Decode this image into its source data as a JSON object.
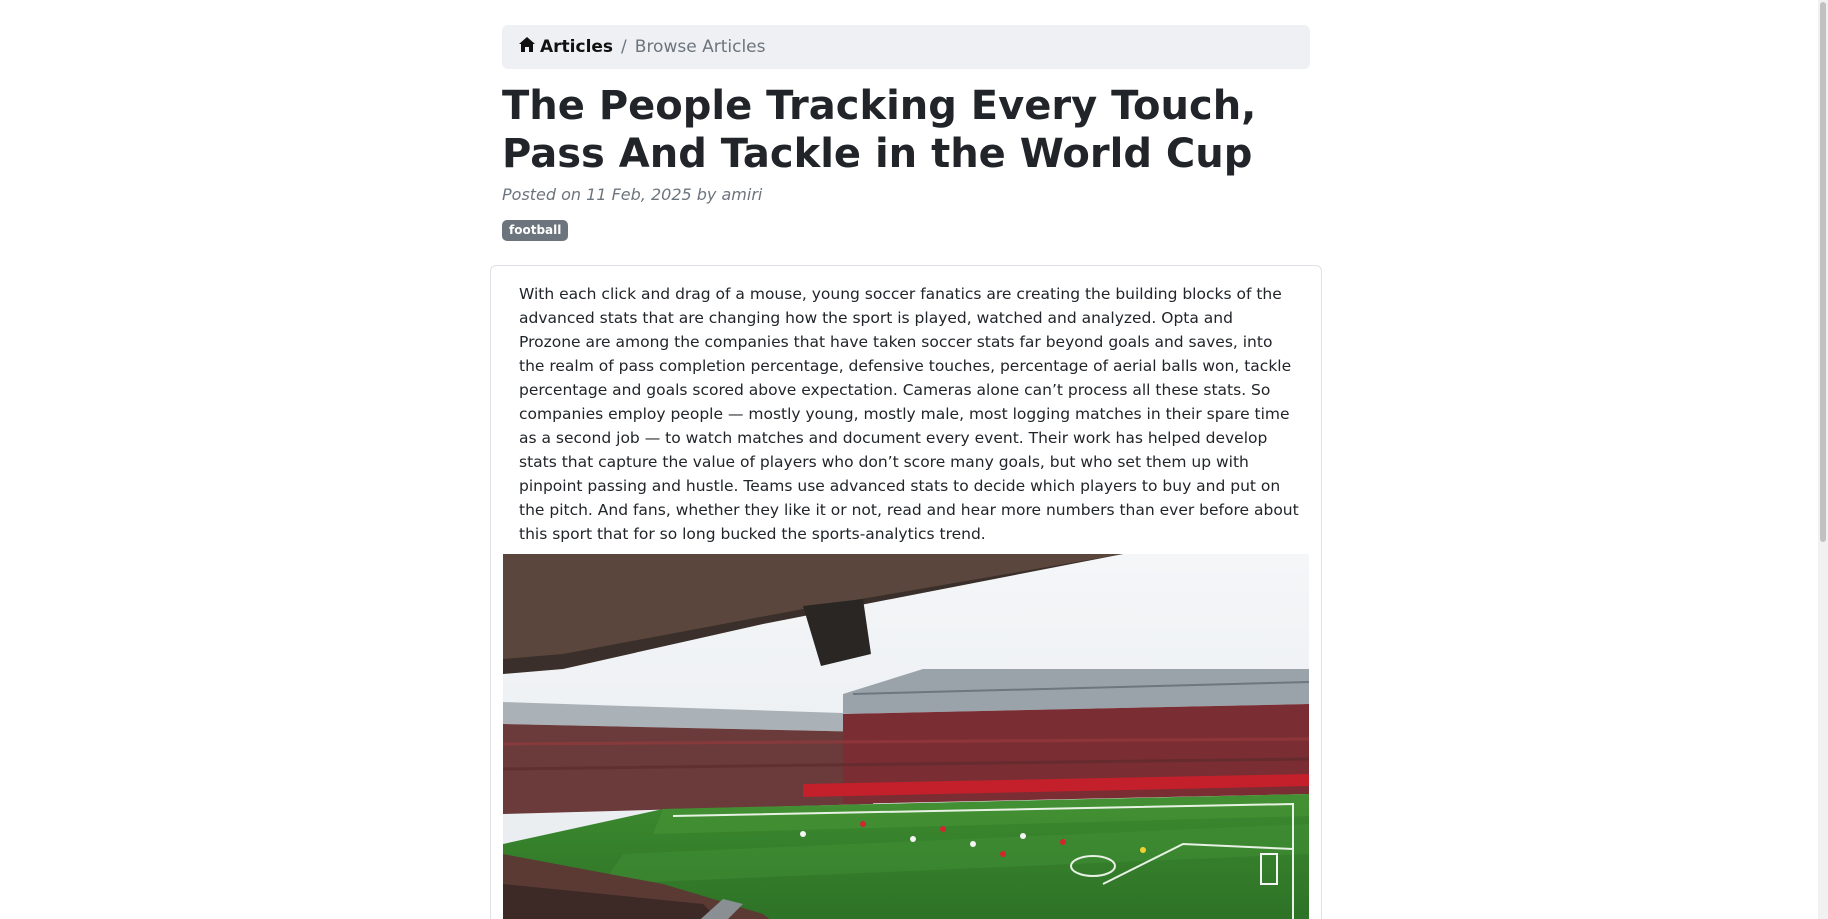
{
  "breadcrumb": {
    "home_icon": "home-icon",
    "home_label": "Articles",
    "separator": "/",
    "current_label": "Browse Articles"
  },
  "article": {
    "title": "The People Tracking Every Touch, Pass And Tackle in the World Cup",
    "meta": "Posted on 11 Feb, 2025 by amiri",
    "tag": "football",
    "body": "With each click and drag of a mouse, young soccer fanatics are creating the building blocks of the advanced stats that are changing how the sport is played, watched and analyzed. Opta and Prozone are among the companies that have taken soccer stats far beyond goals and saves, into the realm of pass completion percentage, defensive touches, percentage of aerial balls won, tackle percentage and goals scored above expectation. Cameras alone can’t process all these stats. So companies employ people — mostly young, mostly male, most logging matches in their spare time as a second job — to watch matches and document every event. Their work has helped develop stats that capture the value of players who don’t score many goals, but who set them up with pinpoint passing and hustle. Teams use advanced stats to decide which players to buy and put on the pitch. And fans, whether they like it or not, read and hear more numbers than ever before about this sport that for so long bucked the sports-analytics trend.",
    "image_icon": "stadium-photo"
  },
  "colors": {
    "breadcrumb_bg": "#eef0f3",
    "tag_bg": "#6c757d",
    "muted": "#6c757d",
    "pitch": "#2f7a2a"
  }
}
